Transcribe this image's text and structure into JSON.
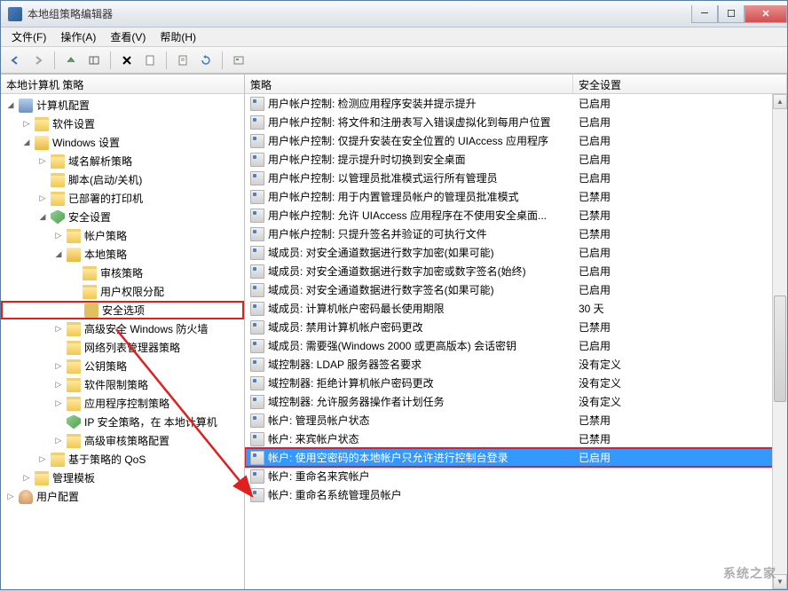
{
  "window": {
    "title": "本地组策略编辑器"
  },
  "menu": {
    "file": "文件(F)",
    "action": "操作(A)",
    "view": "查看(V)",
    "help": "帮助(H)"
  },
  "tree": {
    "header": "本地计算机 策略",
    "root_computer": "计算机配置",
    "n_software": "软件设置",
    "n_windows": "Windows 设置",
    "n_dns": "域名解析策略",
    "n_script": "脚本(启动/关机)",
    "n_printer": "已部署的打印机",
    "n_security": "安全设置",
    "n_account": "帐户策略",
    "n_local": "本地策略",
    "n_audit": "审核策略",
    "n_rights": "用户权限分配",
    "n_secopts": "安全选项",
    "n_firewall": "高级安全 Windows 防火墙",
    "n_netlist": "网络列表管理器策略",
    "n_pubkey": "公钥策略",
    "n_softrestrict": "软件限制策略",
    "n_appctrl": "应用程序控制策略",
    "n_ipsec": "IP 安全策略，在 本地计算机",
    "n_advaudit": "高级审核策略配置",
    "n_qos": "基于策略的 QoS",
    "n_admin": "管理模板",
    "root_user": "用户配置"
  },
  "list": {
    "col_policy": "策略",
    "col_setting": "安全设置",
    "rows": [
      {
        "policy": "用户帐户控制: 检测应用程序安装并提示提升",
        "setting": "已启用"
      },
      {
        "policy": "用户帐户控制: 将文件和注册表写入错误虚拟化到每用户位置",
        "setting": "已启用"
      },
      {
        "policy": "用户帐户控制: 仅提升安装在安全位置的 UIAccess 应用程序",
        "setting": "已启用"
      },
      {
        "policy": "用户帐户控制: 提示提升时切换到安全桌面",
        "setting": "已启用"
      },
      {
        "policy": "用户帐户控制: 以管理员批准模式运行所有管理员",
        "setting": "已启用"
      },
      {
        "policy": "用户帐户控制: 用于内置管理员帐户的管理员批准模式",
        "setting": "已禁用"
      },
      {
        "policy": "用户帐户控制: 允许 UIAccess 应用程序在不使用安全桌面...",
        "setting": "已禁用"
      },
      {
        "policy": "用户帐户控制: 只提升签名并验证的可执行文件",
        "setting": "已禁用"
      },
      {
        "policy": "域成员: 对安全通道数据进行数字加密(如果可能)",
        "setting": "已启用"
      },
      {
        "policy": "域成员: 对安全通道数据进行数字加密或数字签名(始终)",
        "setting": "已启用"
      },
      {
        "policy": "域成员: 对安全通道数据进行数字签名(如果可能)",
        "setting": "已启用"
      },
      {
        "policy": "域成员: 计算机帐户密码最长使用期限",
        "setting": "30 天"
      },
      {
        "policy": "域成员: 禁用计算机帐户密码更改",
        "setting": "已禁用"
      },
      {
        "policy": "域成员: 需要强(Windows 2000 或更高版本) 会话密钥",
        "setting": "已启用"
      },
      {
        "policy": "域控制器: LDAP 服务器签名要求",
        "setting": "没有定义"
      },
      {
        "policy": "域控制器: 拒绝计算机帐户密码更改",
        "setting": "没有定义"
      },
      {
        "policy": "域控制器: 允许服务器操作者计划任务",
        "setting": "没有定义"
      },
      {
        "policy": "帐户: 管理员帐户状态",
        "setting": "已禁用"
      },
      {
        "policy": "帐户: 来宾帐户状态",
        "setting": "已禁用"
      },
      {
        "policy": "帐户: 使用空密码的本地帐户只允许进行控制台登录",
        "setting": "已启用",
        "selected": true,
        "boxed": true
      },
      {
        "policy": "帐户: 重命名来宾帐户",
        "setting": ""
      },
      {
        "policy": "帐户: 重命名系统管理员帐户",
        "setting": ""
      }
    ]
  },
  "watermark": "系统之家"
}
